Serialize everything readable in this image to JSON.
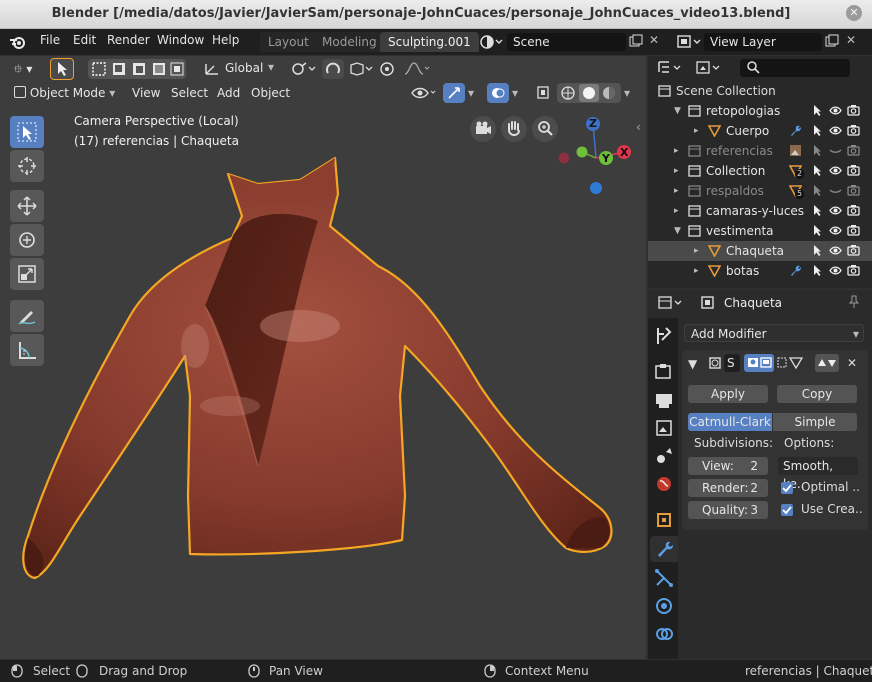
{
  "window_title": "Blender [/media/datos/Javier/JavierSam/personaje-JohnCuaces/personaje_JohnCuaces_video13.blend]",
  "menu": [
    "File",
    "Edit",
    "Render",
    "Window",
    "Help"
  ],
  "workspaces": [
    {
      "label": "Layout",
      "active": false
    },
    {
      "label": "Modeling",
      "active": false
    },
    {
      "label": "Sculpting.001",
      "active": true
    }
  ],
  "scene_field": "Scene",
  "view_layer_field": "View Layer",
  "viewport": {
    "orientation": "Global",
    "mode": "Object Mode",
    "header_menus": [
      "View",
      "Select",
      "Add",
      "Object"
    ],
    "info_line1": "Camera Perspective (Local)",
    "info_line2": "(17) referencias | Chaqueta",
    "gizmo": {
      "z": "Z",
      "y": "Y",
      "x": "X"
    },
    "object_color": "#8a3a2c",
    "outline_color": "#f5a623"
  },
  "outliner": {
    "search_placeholder": "",
    "root": "Scene Collection",
    "rows": [
      {
        "label": "retopologias",
        "dim": false,
        "selected": false
      },
      {
        "label": "Cuerpo",
        "dim": false,
        "selected": false
      },
      {
        "label": "referencias",
        "dim": true,
        "selected": false
      },
      {
        "label": "Collection",
        "dim": false,
        "selected": false,
        "badge": "2"
      },
      {
        "label": "respaldos",
        "dim": true,
        "selected": false,
        "badge": "5"
      },
      {
        "label": "camaras-y-luces",
        "dim": false,
        "selected": false
      },
      {
        "label": "vestimenta",
        "dim": false,
        "selected": false
      },
      {
        "label": "Chaqueta",
        "dim": false,
        "selected": true
      },
      {
        "label": "botas",
        "dim": false,
        "selected": false
      }
    ]
  },
  "properties": {
    "object_name": "Chaqueta",
    "add_modifier": "Add Modifier",
    "modifier_name_short": "S",
    "apply": "Apply",
    "copy": "Copy",
    "catmull": "Catmull-Clark",
    "simple": "Simple",
    "subdivisions_label": "Subdivisions:",
    "options_label": "Options:",
    "view": "View:",
    "view_val": "2",
    "render": "Render:",
    "render_val": "2",
    "quality": "Quality:",
    "quality_val": "3",
    "smooth": "Smooth, ke..",
    "optimal": "Optimal ..",
    "use_crease": "Use Crea.."
  },
  "statusbar": {
    "select": "Select",
    "drag": "Drag and Drop",
    "pan": "Pan View",
    "context": "Context Menu",
    "info": "referencias | Chaqueta | V"
  }
}
